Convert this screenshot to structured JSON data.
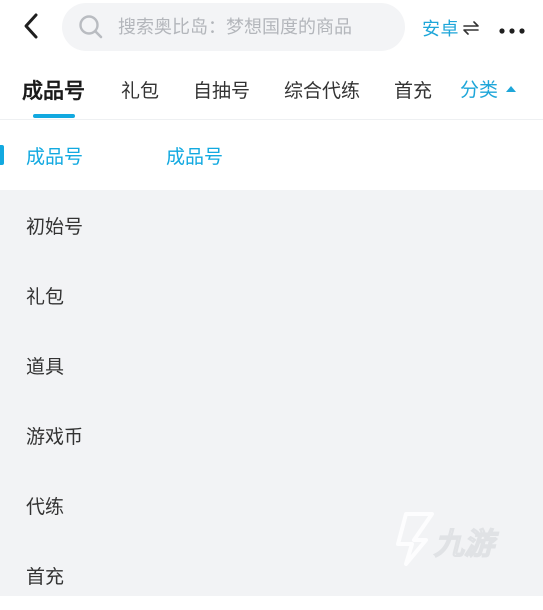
{
  "colors": {
    "accent": "#12a9e0",
    "accent_text": "#1ea6d9",
    "sidebar_bg": "#f2f3f5",
    "search_bg": "#f3f4f6",
    "placeholder": "#b3b6bb"
  },
  "header": {
    "back_icon": "chevron-left-icon",
    "search": {
      "icon": "search-icon",
      "placeholder": "搜索奥比岛：梦想国度的商品",
      "value": ""
    },
    "platform": {
      "label": "安卓",
      "icon": "swap-arrows-icon"
    },
    "more_icon": "more-dots-icon"
  },
  "tabs": {
    "items": [
      {
        "label": "成品号",
        "active": true
      },
      {
        "label": "礼包",
        "active": false
      },
      {
        "label": "自抽号",
        "active": false
      },
      {
        "label": "综合代练",
        "active": false
      },
      {
        "label": "首充",
        "active": false
      }
    ],
    "category_toggle": {
      "label": "分类",
      "icon": "caret-up-icon"
    }
  },
  "sidebar": {
    "items": [
      {
        "label": "成品号",
        "active": true
      },
      {
        "label": "初始号",
        "active": false
      },
      {
        "label": "礼包",
        "active": false
      },
      {
        "label": "道具",
        "active": false
      },
      {
        "label": "游戏币",
        "active": false
      },
      {
        "label": "代练",
        "active": false
      },
      {
        "label": "首充",
        "active": false
      }
    ]
  },
  "content": {
    "title": "成品号"
  },
  "watermark": {
    "text": "九游",
    "icon": "jiuyou-logo-icon"
  }
}
